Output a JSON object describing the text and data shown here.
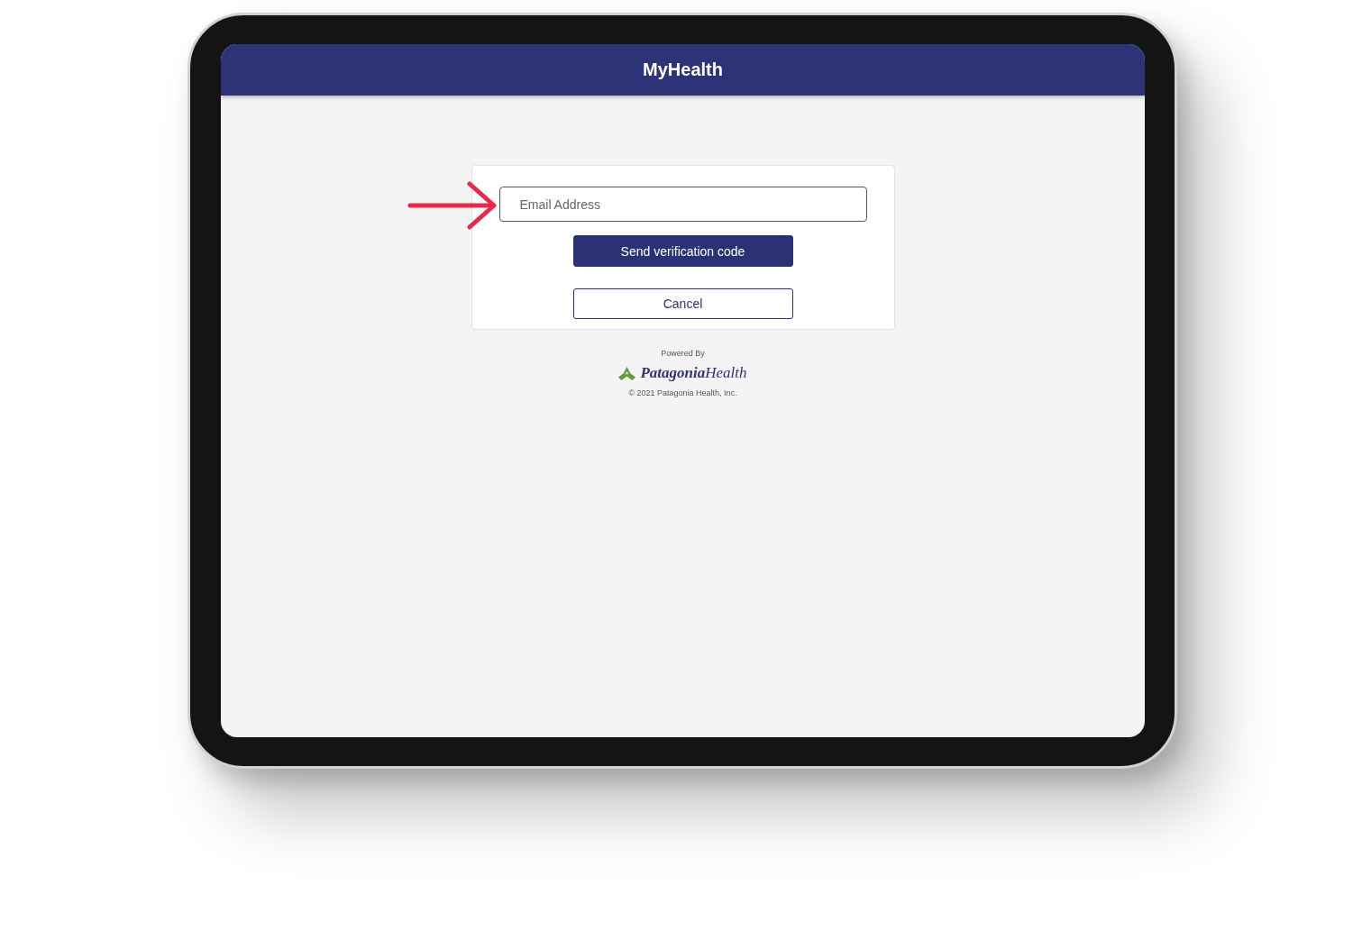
{
  "app_bar": {
    "title": "MyHealth"
  },
  "login_card": {
    "email_field": {
      "placeholder": "Email Address"
    },
    "buttons": [
      {
        "kind": "primary",
        "label": "Send verification code"
      },
      {
        "kind": "secondary",
        "label": "Cancel"
      }
    ]
  },
  "footer": {
    "powered_by": "Powered By",
    "brand": "**Patagonia**Health",
    "copyright": "© 2021 Patagonia Health, Inc."
  }
}
